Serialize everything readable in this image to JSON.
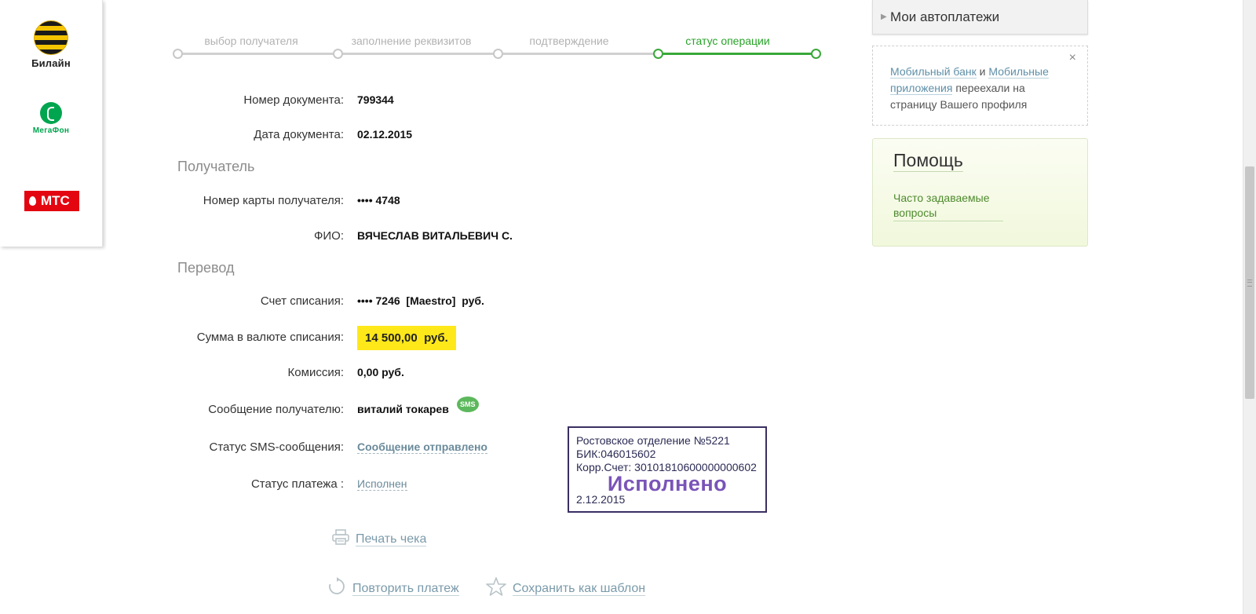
{
  "operators": [
    {
      "name": "Билайн"
    },
    {
      "name": "МегаФон"
    },
    {
      "name": "МТС"
    }
  ],
  "steps": [
    {
      "label": "выбор получателя",
      "active": false
    },
    {
      "label": "заполнение реквизитов",
      "active": false
    },
    {
      "label": "подтверждение",
      "active": false
    },
    {
      "label": "статус операции",
      "active": true
    }
  ],
  "details": {
    "doc_number_label": "Номер документа:",
    "doc_number": "799344",
    "doc_date_label": "Дата документа:",
    "doc_date": "02.12.2015",
    "section_recipient": "Получатель",
    "card_label": "Номер карты получателя:",
    "card": "•••• 4748",
    "fio_label": "ФИО:",
    "fio": "ВЯЧЕСЛАВ ВИТАЛЬЕВИЧ С.",
    "section_transfer": "Перевод",
    "account_label": "Счет списания:",
    "account": "•••• 7246  [Maestro]  руб.",
    "amount_label": "Сумма в валюте списания:",
    "amount": "14 500,00  руб.",
    "fee_label": "Комиссия:",
    "fee": "0,00 руб.",
    "message_label": "Сообщение получателю:",
    "message": "виталий токарев",
    "sms_badge": "SMS",
    "sms_status_label": "Статус SMS-сообщения:",
    "sms_status": "Сообщение отправлено",
    "payment_status_label": "Статус платежа :",
    "payment_status": "Исполнен"
  },
  "stamp": {
    "line1": "Ростовское отделение №5221",
    "line2": "БИК:046015602",
    "line3": "Корр.Счет: 30101810600000000602",
    "big": "Исполнено",
    "date": "2.12.2015"
  },
  "actions": {
    "print": "Печать чека",
    "repeat": "Повторить платеж",
    "save_template": "Сохранить как шаблон"
  },
  "sidebar": {
    "autopay": "Мои автоплатежи",
    "notice_link1": "Мобильный банк",
    "notice_and": " и ",
    "notice_link2": "Мобильные приложения",
    "notice_text": " переехали на страницу Вашего профиля",
    "close": "×",
    "help_title": "Помощь",
    "faq": "Часто задаваемые вопросы"
  }
}
